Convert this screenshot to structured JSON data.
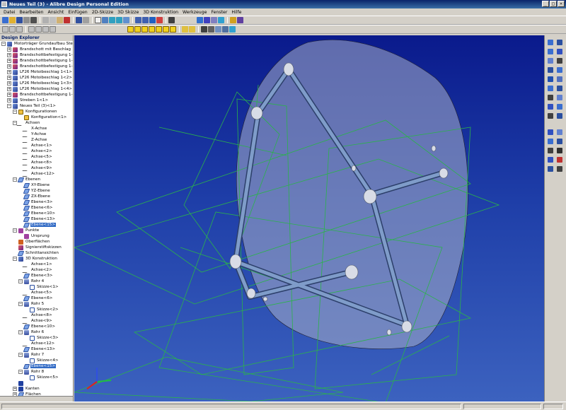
{
  "window": {
    "title": "Neues Teil (3) - Alibre Design Personal Edition",
    "controls": [
      "_",
      "□",
      "×"
    ]
  },
  "menu": [
    "Datei",
    "Bearbeiten",
    "Ansicht",
    "Einfügen",
    "2D-Skizze",
    "3D Skizze",
    "3D Konstruktion",
    "Werkzeuge",
    "Fenster",
    "Hilfe"
  ],
  "explorer": {
    "header": "Design Explorer",
    "rows": [
      {
        "label": "Motorträger Grundaufbau Stel",
        "depth": 0,
        "exp": "−",
        "icon": "part"
      },
      {
        "label": "Brandschott mit Beschlag",
        "depth": 1,
        "exp": "+",
        "icon": "red"
      },
      {
        "label": "Brandschottbefestigung 1-",
        "depth": 1,
        "exp": "+",
        "icon": "red"
      },
      {
        "label": "Brandschottbefestigung 1-",
        "depth": 1,
        "exp": "+",
        "icon": "red"
      },
      {
        "label": "Brandschottbefestigung 1-",
        "depth": 1,
        "exp": "+",
        "icon": "red"
      },
      {
        "label": "LF26 Motoibeschlag 1<1>",
        "depth": 1,
        "exp": "+",
        "icon": "part"
      },
      {
        "label": "LF26 Motoibeschlag 1<2>",
        "depth": 1,
        "exp": "+",
        "icon": "part"
      },
      {
        "label": "LF26 Motoibeschlag 1<3>",
        "depth": 1,
        "exp": "+",
        "icon": "part"
      },
      {
        "label": "LF26 Motoibeschlag 1<4>",
        "depth": 1,
        "exp": "+",
        "icon": "part"
      },
      {
        "label": "Brandschottbefestigung 1-",
        "depth": 1,
        "exp": "+",
        "icon": "red"
      },
      {
        "label": "Streben 1<1>",
        "depth": 1,
        "exp": "+",
        "icon": "part"
      },
      {
        "label": "Neues Teil (3)<1>",
        "depth": 1,
        "exp": "−",
        "icon": "part"
      },
      {
        "label": "Konfigurationen",
        "depth": 2,
        "exp": "−",
        "icon": "cfg"
      },
      {
        "label": "Konfiguration<1>",
        "depth": 3,
        "exp": "",
        "icon": "cfg"
      },
      {
        "label": "Achsen",
        "depth": 2,
        "exp": "−",
        "icon": "axis"
      },
      {
        "label": "X-Achse",
        "depth": 3,
        "exp": "",
        "icon": "axis"
      },
      {
        "label": "Y-Achse",
        "depth": 3,
        "exp": "",
        "icon": "axis"
      },
      {
        "label": "Z-Achse",
        "depth": 3,
        "exp": "",
        "icon": "axis"
      },
      {
        "label": "Achse<1>",
        "depth": 3,
        "exp": "",
        "icon": "axis"
      },
      {
        "label": "Achse<2>",
        "depth": 3,
        "exp": "",
        "icon": "axis"
      },
      {
        "label": "Achse<5>",
        "depth": 3,
        "exp": "",
        "icon": "axis"
      },
      {
        "label": "Achse<8>",
        "depth": 3,
        "exp": "",
        "icon": "axis"
      },
      {
        "label": "Achse<9>",
        "depth": 3,
        "exp": "",
        "icon": "axis"
      },
      {
        "label": "Achse<12>",
        "depth": 3,
        "exp": "",
        "icon": "axis"
      },
      {
        "label": "Ebenen",
        "depth": 2,
        "exp": "−",
        "icon": "plane"
      },
      {
        "label": "XY-Ebene",
        "depth": 3,
        "exp": "",
        "icon": "plane"
      },
      {
        "label": "YZ-Ebene",
        "depth": 3,
        "exp": "",
        "icon": "plane"
      },
      {
        "label": "ZX-Ebene",
        "depth": 3,
        "exp": "",
        "icon": "plane"
      },
      {
        "label": "Ebene<3>",
        "depth": 3,
        "exp": "",
        "icon": "plane"
      },
      {
        "label": "Ebene<6>",
        "depth": 3,
        "exp": "",
        "icon": "plane"
      },
      {
        "label": "Ebene<10>",
        "depth": 3,
        "exp": "",
        "icon": "plane"
      },
      {
        "label": "Ebene<13>",
        "depth": 3,
        "exp": "",
        "icon": "plane"
      },
      {
        "label": "Ebene<15>",
        "depth": 3,
        "exp": "",
        "icon": "plane",
        "selected": true
      },
      {
        "label": "Punkte",
        "depth": 2,
        "exp": "−",
        "icon": "point"
      },
      {
        "label": "Ursprung",
        "depth": 3,
        "exp": "",
        "icon": "point"
      },
      {
        "label": "Oberflächen",
        "depth": 2,
        "exp": "",
        "icon": "surf"
      },
      {
        "label": "Signierstiftskizzen",
        "depth": 2,
        "exp": "",
        "icon": "red"
      },
      {
        "label": "Schnittansichten",
        "depth": 2,
        "exp": "",
        "icon": "plane"
      },
      {
        "label": "3D Konstruktion",
        "depth": 2,
        "exp": "−",
        "icon": "part"
      },
      {
        "label": "Achse<1>",
        "depth": 3,
        "exp": "",
        "icon": "axis"
      },
      {
        "label": "Achse<2>",
        "depth": 3,
        "exp": "",
        "icon": "axis"
      },
      {
        "label": "Ebene<3>",
        "depth": 3,
        "exp": "",
        "icon": "plane"
      },
      {
        "label": "Rohr 4",
        "depth": 3,
        "exp": "−",
        "icon": "pipe"
      },
      {
        "label": "Skizze<1>",
        "depth": 4,
        "exp": "",
        "icon": "sketch"
      },
      {
        "label": "Achse<5>",
        "depth": 3,
        "exp": "",
        "icon": "axis"
      },
      {
        "label": "Ebene<6>",
        "depth": 3,
        "exp": "",
        "icon": "plane"
      },
      {
        "label": "Rohr 5",
        "depth": 3,
        "exp": "−",
        "icon": "pipe"
      },
      {
        "label": "Skizze<2>",
        "depth": 4,
        "exp": "",
        "icon": "sketch"
      },
      {
        "label": "Achse<8>",
        "depth": 3,
        "exp": "",
        "icon": "axis"
      },
      {
        "label": "Achse<9>",
        "depth": 3,
        "exp": "",
        "icon": "axis"
      },
      {
        "label": "Ebene<10>",
        "depth": 3,
        "exp": "",
        "icon": "plane"
      },
      {
        "label": "Rohr 6",
        "depth": 3,
        "exp": "−",
        "icon": "pipe"
      },
      {
        "label": "Skizze<3>",
        "depth": 4,
        "exp": "",
        "icon": "sketch"
      },
      {
        "label": "Achse<12>",
        "depth": 3,
        "exp": "",
        "icon": "axis"
      },
      {
        "label": "Ebene<13>",
        "depth": 3,
        "exp": "",
        "icon": "plane"
      },
      {
        "label": "Rohr 7",
        "depth": 3,
        "exp": "−",
        "icon": "pipe"
      },
      {
        "label": "Skizze<4>",
        "depth": 4,
        "exp": "",
        "icon": "sketch"
      },
      {
        "label": "Ebene<15>",
        "depth": 3,
        "exp": "",
        "icon": "plane",
        "selected": true
      },
      {
        "label": "Rohr 8",
        "depth": 3,
        "exp": "−",
        "icon": "pipe"
      },
      {
        "label": "Skizze<5>",
        "depth": 4,
        "exp": "",
        "icon": "sketch"
      },
      {
        "label": "",
        "depth": 2,
        "exp": "",
        "icon": "edge"
      },
      {
        "label": "Kanten",
        "depth": 2,
        "exp": "+",
        "icon": "edge"
      },
      {
        "label": "Flächen",
        "depth": 2,
        "exp": "+",
        "icon": "plane"
      }
    ]
  },
  "viewport": {
    "axis_indicator": [
      "x",
      "y",
      "z"
    ]
  },
  "colors": {
    "bg_top": "#0a1a8c",
    "bg_bottom": "#3c62bf",
    "plane_lines": "#2bb34a",
    "tube": "#6f8fc0",
    "selection": "#316ac5"
  }
}
